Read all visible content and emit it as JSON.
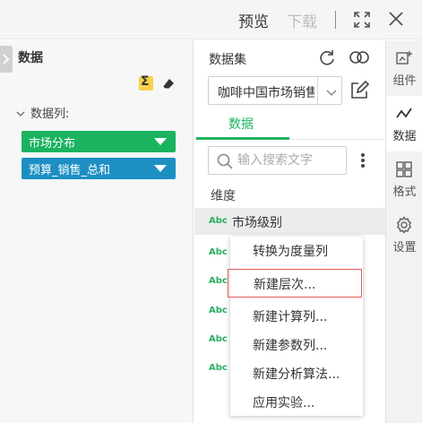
{
  "topbar": {
    "preview": "预览",
    "download": "下载"
  },
  "left": {
    "title": "数据",
    "columns_label": "数据列:",
    "pills": [
      "市场分布",
      "预算_销售_总和"
    ]
  },
  "middle": {
    "dataset_label": "数据集",
    "dataset_value": "咖啡中国市场销售",
    "tab_data": "数据",
    "search_placeholder": "输入搜索文字",
    "dimension_label": "维度",
    "abc_tag": "Abc",
    "active_field": "市场级别"
  },
  "menu": {
    "items": [
      "转换为度量列",
      "新建层次...",
      "新建计算列...",
      "新建参数列...",
      "新建分析算法...",
      "应用实验..."
    ]
  },
  "rail": {
    "items": [
      "组件",
      "数据",
      "格式",
      "设置"
    ]
  },
  "colors": {
    "accent": "#1bb35f",
    "pill_blue": "#1d8fc3",
    "highlight_border": "#e05a5a"
  }
}
